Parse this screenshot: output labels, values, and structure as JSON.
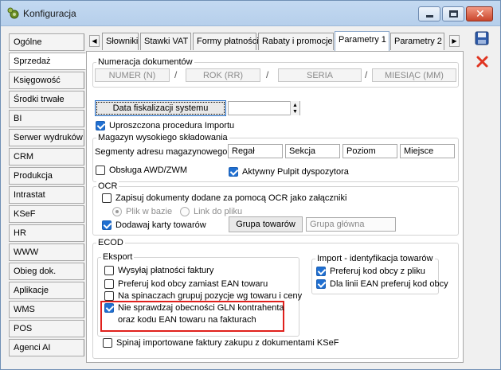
{
  "window": {
    "title": "Konfiguracja"
  },
  "nav": {
    "items": [
      "Ogólne",
      "Sprzedaż",
      "Księgowość",
      "Środki trwałe",
      "BI",
      "Serwer wydruków",
      "CRM",
      "Produkcja",
      "Intrastat",
      "KSeF",
      "HR",
      "WWW",
      "Obieg dok.",
      "Aplikacje",
      "WMS",
      "POS",
      "Agenci AI"
    ],
    "active": "Sprzedaż"
  },
  "tabs": {
    "items": [
      "Słowniki",
      "Stawki VAT",
      "Formy płatności",
      "Rabaty i promocje",
      "Parametry 1",
      "Parametry 2"
    ],
    "active": "Parametry 1"
  },
  "numeracja": {
    "label": "Numeracja dokumentów",
    "fields": [
      "NUMER (N)",
      "ROK (RR)",
      "SERIA",
      "MIESIĄC (MM)"
    ],
    "separator": "/"
  },
  "fiskalizacja": {
    "button": "Data fiskalizacji systemu",
    "value": ""
  },
  "import_uproszczony": {
    "label": "Uproszczona procedura Importu",
    "checked": true
  },
  "magazyn": {
    "label": "Magazyn wysokiego składowania",
    "segments_label": "Segmenty adresu magazynowego:",
    "segments": [
      "Regał",
      "Sekcja",
      "Poziom",
      "Miejsce"
    ],
    "awd_label": "Obsługa AWD/ZWM",
    "awd_checked": false,
    "pulpit_label": "Aktywny Pulpit dyspozytora",
    "pulpit_checked": true
  },
  "ocr": {
    "label": "OCR",
    "zapisuj_label": "Zapisuj dokumenty dodane za pomocą OCR jako załączniki",
    "zapisuj_checked": false,
    "plik_label": "Plik w bazie",
    "link_label": "Link do pliku",
    "karty_label": "Dodawaj karty towarów",
    "karty_checked": true,
    "grupa_button": "Grupa towarów",
    "grupa_value": "Grupa główna"
  },
  "ecod": {
    "label": "ECOD",
    "eksport": {
      "label": "Eksport",
      "items": [
        {
          "label": "Wysyłaj płatności faktury",
          "checked": false
        },
        {
          "label": "Preferuj kod obcy zamiast EAN towaru",
          "checked": false
        },
        {
          "label": "Na spinaczach grupuj pozycje wg towaru i ceny",
          "checked": false
        }
      ],
      "gln_line1": "Nie sprawdzaj obecności GLN kontrahenta",
      "gln_line2": "oraz kodu EAN towaru na fakturach",
      "gln_checked": true
    },
    "import": {
      "label": "Import - identyfikacja towarów",
      "items": [
        {
          "label": "Preferuj kod obcy z pliku",
          "checked": true
        },
        {
          "label": "Dla linii EAN preferuj kod obcy",
          "checked": true
        }
      ]
    },
    "spinaj_label": "Spinaj importowane faktury zakupu z dokumentami KSeF",
    "spinaj_checked": false
  },
  "colors": {
    "accent": "#1f6fd1",
    "highlight": "#e0201c"
  },
  "icons": {
    "save": "save-icon",
    "cancel": "close-icon"
  }
}
